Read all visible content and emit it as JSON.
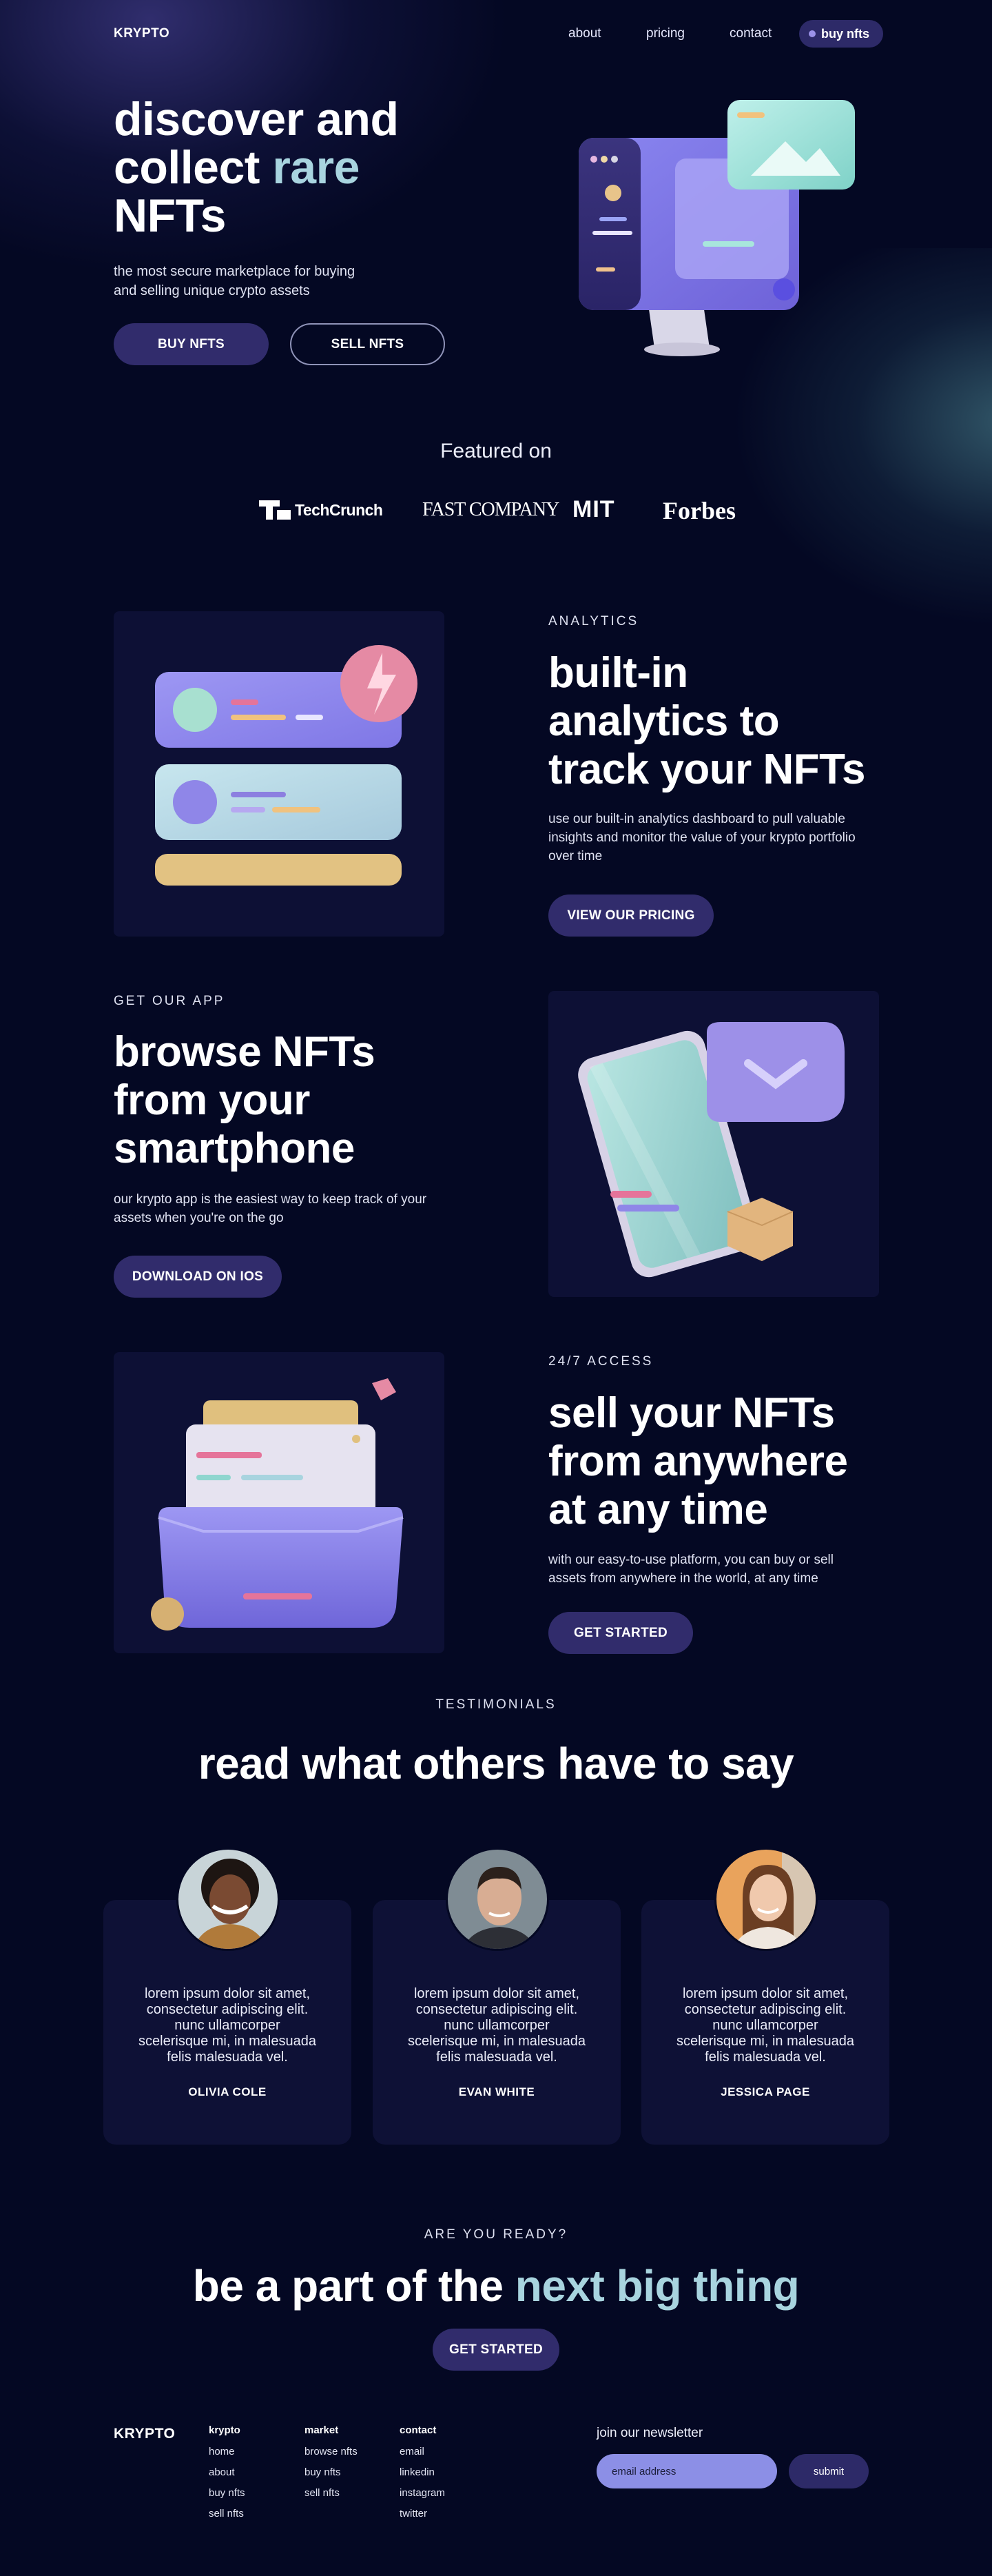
{
  "nav": {
    "logo": "KRYPTO",
    "links": [
      "about",
      "pricing",
      "contact"
    ],
    "cta": "buy nfts"
  },
  "hero": {
    "title_line1": "discover and",
    "title_line2_a": "collect ",
    "title_line2_b": "rare",
    "title_line3": "NFTs",
    "subtitle_line1": "the most secure marketplace for buying",
    "subtitle_line2": "and selling unique crypto assets",
    "primary_button": "BUY NFTS",
    "secondary_button": "SELL NFTS"
  },
  "featured": {
    "heading": "Featured on",
    "brands": [
      "TechCrunch",
      "FAST COMPANY",
      "MIT",
      "Forbes"
    ]
  },
  "analytics": {
    "eyebrow": "ANALYTICS",
    "title_lines": [
      "built-in",
      "analytics to",
      "track your NFTs"
    ],
    "body_lines": [
      "use our built-in analytics dashboard to pull valuable",
      "insights and monitor the value of your krypto portfolio",
      "over time"
    ],
    "button": "VIEW OUR PRICING"
  },
  "app": {
    "eyebrow": "GET OUR APP",
    "title_lines": [
      "browse NFTs",
      "from your",
      "smartphone"
    ],
    "body_lines": [
      "our krypto app is the easiest way to keep track of your",
      "assets when you're on the go"
    ],
    "button": "DOWNLOAD ON IOS"
  },
  "access": {
    "eyebrow": "24/7 ACCESS",
    "title_lines": [
      "sell your NFTs",
      "from anywhere",
      "at any time"
    ],
    "body_lines": [
      "with our easy-to-use platform, you can buy or sell",
      "assets from anywhere in the world, at any time"
    ],
    "button": "GET STARTED"
  },
  "testimonials": {
    "eyebrow": "TESTIMONIALS",
    "title": "read what others have to say",
    "items": [
      {
        "text_lines": [
          "lorem ipsum dolor sit amet,",
          "consectetur adipiscing elit.",
          "nunc ullamcorper",
          "scelerisque mi, in malesuada",
          "felis malesuada vel."
        ],
        "name": "OLIVIA COLE"
      },
      {
        "text_lines": [
          "lorem ipsum dolor sit amet,",
          "consectetur adipiscing elit.",
          "nunc ullamcorper",
          "scelerisque mi, in malesuada",
          "felis malesuada vel."
        ],
        "name": "EVAN WHITE"
      },
      {
        "text_lines": [
          "lorem ipsum dolor sit amet,",
          "consectetur adipiscing elit.",
          "nunc ullamcorper",
          "scelerisque mi, in malesuada",
          "felis malesuada vel."
        ],
        "name": "JESSICA PAGE"
      }
    ]
  },
  "cta": {
    "eyebrow": "ARE YOU READY?",
    "title_a": "be a part of the ",
    "title_b": "next big thing",
    "button": "GET STARTED"
  },
  "footer": {
    "logo": "KRYPTO",
    "columns": [
      {
        "heading": "krypto",
        "links": [
          "home",
          "about",
          "buy nfts",
          "sell nfts"
        ]
      },
      {
        "heading": "market",
        "links": [
          "browse nfts",
          "buy nfts",
          "sell nfts"
        ]
      },
      {
        "heading": "contact",
        "links": [
          "email",
          "linkedin",
          "instagram",
          "twitter"
        ]
      }
    ],
    "newsletter": {
      "heading": "join our newsletter",
      "placeholder": "email address",
      "button": "submit"
    }
  },
  "colors": {
    "background": "#040823",
    "primary": "#312c6c",
    "accent": "#a8d4df",
    "lavender": "#8c8fe6"
  }
}
